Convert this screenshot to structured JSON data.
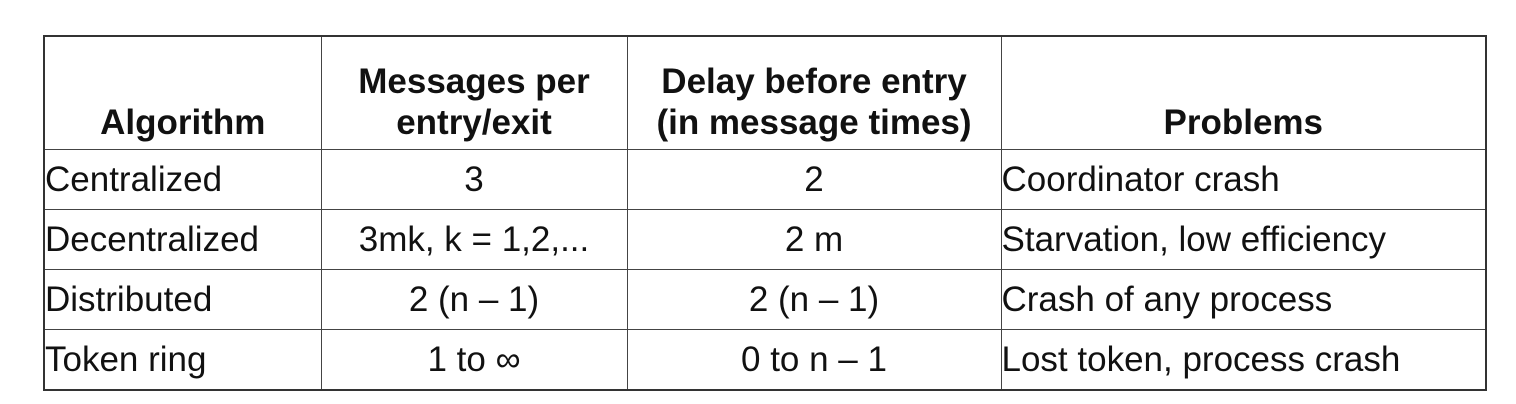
{
  "table": {
    "headers": {
      "algorithm": "Algorithm",
      "messages_line1": "Messages per",
      "messages_line2": "entry/exit",
      "delay_line1": "Delay before entry",
      "delay_line2": "(in message times)",
      "problems": "Problems"
    },
    "rows": [
      {
        "algorithm": "Centralized",
        "messages": "3",
        "delay": "2",
        "problems": "Coordinator crash"
      },
      {
        "algorithm": "Decentralized",
        "messages": "3mk, k = 1,2,...",
        "delay": "2 m",
        "problems": "Starvation, low efficiency"
      },
      {
        "algorithm": "Distributed",
        "messages": "2 (n – 1)",
        "delay": "2 (n – 1)",
        "problems": "Crash of any process"
      },
      {
        "algorithm": "Token ring",
        "messages": "1 to ∞",
        "delay": "0 to n – 1",
        "problems": "Lost token, process crash"
      }
    ]
  }
}
